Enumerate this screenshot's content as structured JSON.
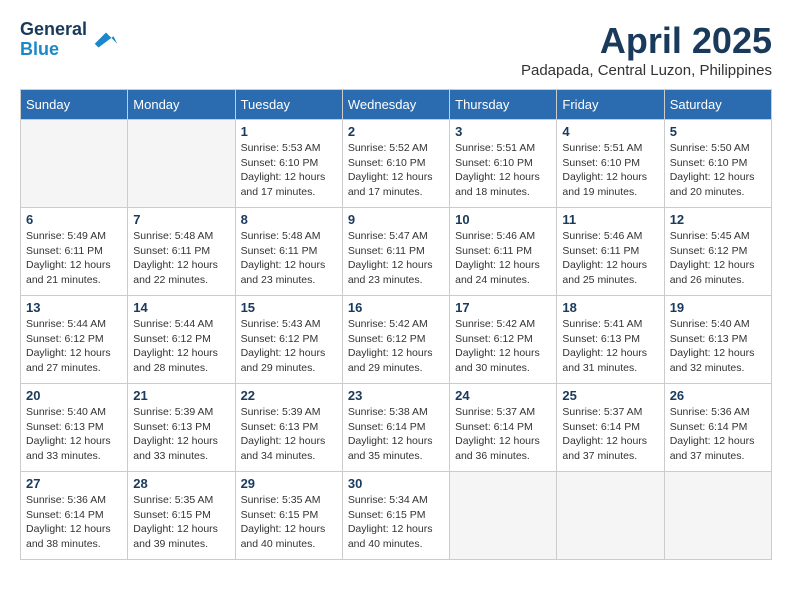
{
  "header": {
    "logo_line1": "General",
    "logo_line2": "Blue",
    "month_title": "April 2025",
    "location": "Padapada, Central Luzon, Philippines"
  },
  "days_of_week": [
    "Sunday",
    "Monday",
    "Tuesday",
    "Wednesday",
    "Thursday",
    "Friday",
    "Saturday"
  ],
  "weeks": [
    [
      {
        "day": "",
        "empty": true
      },
      {
        "day": "",
        "empty": true
      },
      {
        "day": "1",
        "sunrise": "5:53 AM",
        "sunset": "6:10 PM",
        "daylight": "12 hours and 17 minutes."
      },
      {
        "day": "2",
        "sunrise": "5:52 AM",
        "sunset": "6:10 PM",
        "daylight": "12 hours and 17 minutes."
      },
      {
        "day": "3",
        "sunrise": "5:51 AM",
        "sunset": "6:10 PM",
        "daylight": "12 hours and 18 minutes."
      },
      {
        "day": "4",
        "sunrise": "5:51 AM",
        "sunset": "6:10 PM",
        "daylight": "12 hours and 19 minutes."
      },
      {
        "day": "5",
        "sunrise": "5:50 AM",
        "sunset": "6:10 PM",
        "daylight": "12 hours and 20 minutes."
      }
    ],
    [
      {
        "day": "6",
        "sunrise": "5:49 AM",
        "sunset": "6:11 PM",
        "daylight": "12 hours and 21 minutes."
      },
      {
        "day": "7",
        "sunrise": "5:48 AM",
        "sunset": "6:11 PM",
        "daylight": "12 hours and 22 minutes."
      },
      {
        "day": "8",
        "sunrise": "5:48 AM",
        "sunset": "6:11 PM",
        "daylight": "12 hours and 23 minutes."
      },
      {
        "day": "9",
        "sunrise": "5:47 AM",
        "sunset": "6:11 PM",
        "daylight": "12 hours and 23 minutes."
      },
      {
        "day": "10",
        "sunrise": "5:46 AM",
        "sunset": "6:11 PM",
        "daylight": "12 hours and 24 minutes."
      },
      {
        "day": "11",
        "sunrise": "5:46 AM",
        "sunset": "6:11 PM",
        "daylight": "12 hours and 25 minutes."
      },
      {
        "day": "12",
        "sunrise": "5:45 AM",
        "sunset": "6:12 PM",
        "daylight": "12 hours and 26 minutes."
      }
    ],
    [
      {
        "day": "13",
        "sunrise": "5:44 AM",
        "sunset": "6:12 PM",
        "daylight": "12 hours and 27 minutes."
      },
      {
        "day": "14",
        "sunrise": "5:44 AM",
        "sunset": "6:12 PM",
        "daylight": "12 hours and 28 minutes."
      },
      {
        "day": "15",
        "sunrise": "5:43 AM",
        "sunset": "6:12 PM",
        "daylight": "12 hours and 29 minutes."
      },
      {
        "day": "16",
        "sunrise": "5:42 AM",
        "sunset": "6:12 PM",
        "daylight": "12 hours and 29 minutes."
      },
      {
        "day": "17",
        "sunrise": "5:42 AM",
        "sunset": "6:12 PM",
        "daylight": "12 hours and 30 minutes."
      },
      {
        "day": "18",
        "sunrise": "5:41 AM",
        "sunset": "6:13 PM",
        "daylight": "12 hours and 31 minutes."
      },
      {
        "day": "19",
        "sunrise": "5:40 AM",
        "sunset": "6:13 PM",
        "daylight": "12 hours and 32 minutes."
      }
    ],
    [
      {
        "day": "20",
        "sunrise": "5:40 AM",
        "sunset": "6:13 PM",
        "daylight": "12 hours and 33 minutes."
      },
      {
        "day": "21",
        "sunrise": "5:39 AM",
        "sunset": "6:13 PM",
        "daylight": "12 hours and 33 minutes."
      },
      {
        "day": "22",
        "sunrise": "5:39 AM",
        "sunset": "6:13 PM",
        "daylight": "12 hours and 34 minutes."
      },
      {
        "day": "23",
        "sunrise": "5:38 AM",
        "sunset": "6:14 PM",
        "daylight": "12 hours and 35 minutes."
      },
      {
        "day": "24",
        "sunrise": "5:37 AM",
        "sunset": "6:14 PM",
        "daylight": "12 hours and 36 minutes."
      },
      {
        "day": "25",
        "sunrise": "5:37 AM",
        "sunset": "6:14 PM",
        "daylight": "12 hours and 37 minutes."
      },
      {
        "day": "26",
        "sunrise": "5:36 AM",
        "sunset": "6:14 PM",
        "daylight": "12 hours and 37 minutes."
      }
    ],
    [
      {
        "day": "27",
        "sunrise": "5:36 AM",
        "sunset": "6:14 PM",
        "daylight": "12 hours and 38 minutes."
      },
      {
        "day": "28",
        "sunrise": "5:35 AM",
        "sunset": "6:15 PM",
        "daylight": "12 hours and 39 minutes."
      },
      {
        "day": "29",
        "sunrise": "5:35 AM",
        "sunset": "6:15 PM",
        "daylight": "12 hours and 40 minutes."
      },
      {
        "day": "30",
        "sunrise": "5:34 AM",
        "sunset": "6:15 PM",
        "daylight": "12 hours and 40 minutes."
      },
      {
        "day": "",
        "empty": true
      },
      {
        "day": "",
        "empty": true
      },
      {
        "day": "",
        "empty": true
      }
    ]
  ],
  "labels": {
    "sunrise": "Sunrise:",
    "sunset": "Sunset:",
    "daylight": "Daylight:"
  }
}
